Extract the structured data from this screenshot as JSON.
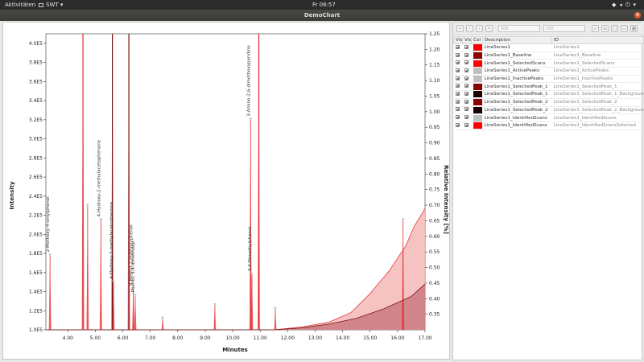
{
  "topbar": {
    "activities": "Aktivitäten",
    "app": "SWT ▾",
    "clock": "Fr 06:57"
  },
  "window": {
    "title": "DemoChart"
  },
  "colors": {
    "series": "#e8252a",
    "baseline": "#7a1010",
    "area_fill": "#f5b8b8",
    "area_dark": "#c9777d"
  },
  "toolbar": {
    "field_from": "100",
    "field_to": "100"
  },
  "table": {
    "headers": [
      "Vis",
      "Vis",
      "Col",
      "Description",
      "ID"
    ],
    "rows": [
      {
        "description": "LineSeries1",
        "id": "LineSeries1",
        "color": "#ff0000"
      },
      {
        "description": "LineSeries1_Baseline",
        "id": "LineSeries1_Baseline",
        "color": "#8b0000"
      },
      {
        "description": "LineSeries1_SelectedScans",
        "id": "LineSeries1_SelectedScans",
        "color": "#ff0000"
      },
      {
        "description": "LineSeries1_ActivePeaks",
        "id": "LineSeries1_ActivePeaks",
        "color": "#c0c0c0"
      },
      {
        "description": "LineSeries1_InactivePeaks",
        "id": "LineSeries1_InactivePeaks",
        "color": "#c0c0c0"
      },
      {
        "description": "LineSeries1_SelectedPeak_1",
        "id": "LineSeries1_SelectedPeak_1",
        "color": "#8b0000"
      },
      {
        "description": "LineSeries1_SelectedPeak_1",
        "id": "LineSeries1_SelectedPeak_1_Background",
        "color": "#1a0000"
      },
      {
        "description": "LineSeries1_SelectedPeak_2",
        "id": "LineSeries1_SelectedPeak_2",
        "color": "#8b0000"
      },
      {
        "description": "LineSeries1_SelectedPeak_2",
        "id": "LineSeries1_SelectedPeak_2_Background",
        "color": "#1a0000"
      },
      {
        "description": "LineSeries1_IdentifiedScans",
        "id": "LineSeries1_IdentifiedScans",
        "color": "#c0c0c0"
      },
      {
        "description": "LineSeries1_IdentifiedScans",
        "id": "LineSeries1_IdentifiedScansSelected",
        "color": "#ff0000"
      }
    ]
  },
  "chart_data": {
    "type": "line",
    "xlabel": "Minutes",
    "ylabel": "Intensity",
    "y2label": "Relative Intensity [%]",
    "xlim": [
      3.2,
      17.0
    ],
    "ylim": [
      1.0,
      4.1
    ],
    "y2lim": [
      0.3,
      1.25
    ],
    "x_ticks": [
      "4.00",
      "5.00",
      "6.00",
      "7.00",
      "8.00",
      "9.00",
      "10.00",
      "11.00",
      "12.00",
      "13.00",
      "14.00",
      "15.00",
      "16.00",
      "17.00"
    ],
    "y_ticks": [
      "1.0E5",
      "1.2E5",
      "1.4E5",
      "1.6E5",
      "1.8E5",
      "2.0E5",
      "2.2E5",
      "2.4E5",
      "2.6E5",
      "2.8E5",
      "3.0E5",
      "3.2E5",
      "3.4E5",
      "3.6E5",
      "3.8E5",
      "4.0E5"
    ],
    "y_tick_values": [
      1.0,
      1.2,
      1.4,
      1.6,
      1.8,
      2.0,
      2.2,
      2.4,
      2.6,
      2.8,
      3.0,
      3.2,
      3.4,
      3.6,
      3.8,
      4.0
    ],
    "y2_ticks": [
      "0.35",
      "0.40",
      "0.45",
      "0.50",
      "0.55",
      "0.60",
      "0.65",
      "0.70",
      "0.75",
      "0.80",
      "0.85",
      "0.90",
      "0.95",
      "1.00",
      "1.05",
      "1.10",
      "1.15",
      "1.20",
      "1.25"
    ],
    "y2_tick_values": [
      0.35,
      0.4,
      0.45,
      0.5,
      0.55,
      0.6,
      0.65,
      0.7,
      0.75,
      0.8,
      0.85,
      0.9,
      0.95,
      1.0,
      1.05,
      1.1,
      1.15,
      1.2,
      1.25
    ],
    "peaks": [
      {
        "x": 3.35,
        "y": 1.78,
        "label": "2-Methoxy-4-vinylphenol"
      },
      {
        "x": 4.55,
        "y": 4.1,
        "label": ""
      },
      {
        "x": 4.72,
        "y": 2.3,
        "label": ""
      },
      {
        "x": 5.2,
        "y": 2.15,
        "label": "4-Hydroxy-2-methylacetophenone"
      },
      {
        "x": 5.62,
        "y": 4.1,
        "label": ""
      },
      {
        "x": 5.66,
        "y": 1.5,
        "label": "4-Hydroxy-3-methylacetophenone"
      },
      {
        "x": 6.22,
        "y": 4.1,
        "label": ""
      },
      {
        "x": 6.38,
        "y": 1.43,
        "label": "4-Methyl-2-methoxyphenol"
      },
      {
        "x": 6.45,
        "y": 1.36,
        "label": "Phenol, 3,4-dimethoxy-"
      },
      {
        "x": 7.45,
        "y": 1.12,
        "label": ""
      },
      {
        "x": 9.35,
        "y": 1.26,
        "label": ""
      },
      {
        "x": 10.65,
        "y": 3.2,
        "label": "3-Amino-2,6-dimethoxypyridine"
      },
      {
        "x": 10.7,
        "y": 1.58,
        "label": "2,4-Dimethylphenol"
      },
      {
        "x": 10.95,
        "y": 4.1,
        "label": ""
      },
      {
        "x": 11.55,
        "y": 1.22,
        "label": ""
      },
      {
        "x": 16.2,
        "y": 2.15,
        "label": ""
      }
    ],
    "baseline": {
      "x": [
        3.2,
        11.5,
        12.5,
        13.5,
        14.5,
        15.5,
        16.5,
        17.0
      ],
      "y": [
        1.0,
        1.0,
        1.02,
        1.06,
        1.12,
        1.22,
        1.35,
        1.48
      ]
    },
    "rising_area": {
      "x": [
        11.5,
        12.5,
        13.5,
        14.3,
        15.0,
        15.7,
        16.3,
        16.6,
        17.0
      ],
      "y": [
        1.0,
        1.03,
        1.08,
        1.18,
        1.38,
        1.62,
        1.88,
        2.08,
        2.27
      ]
    }
  }
}
